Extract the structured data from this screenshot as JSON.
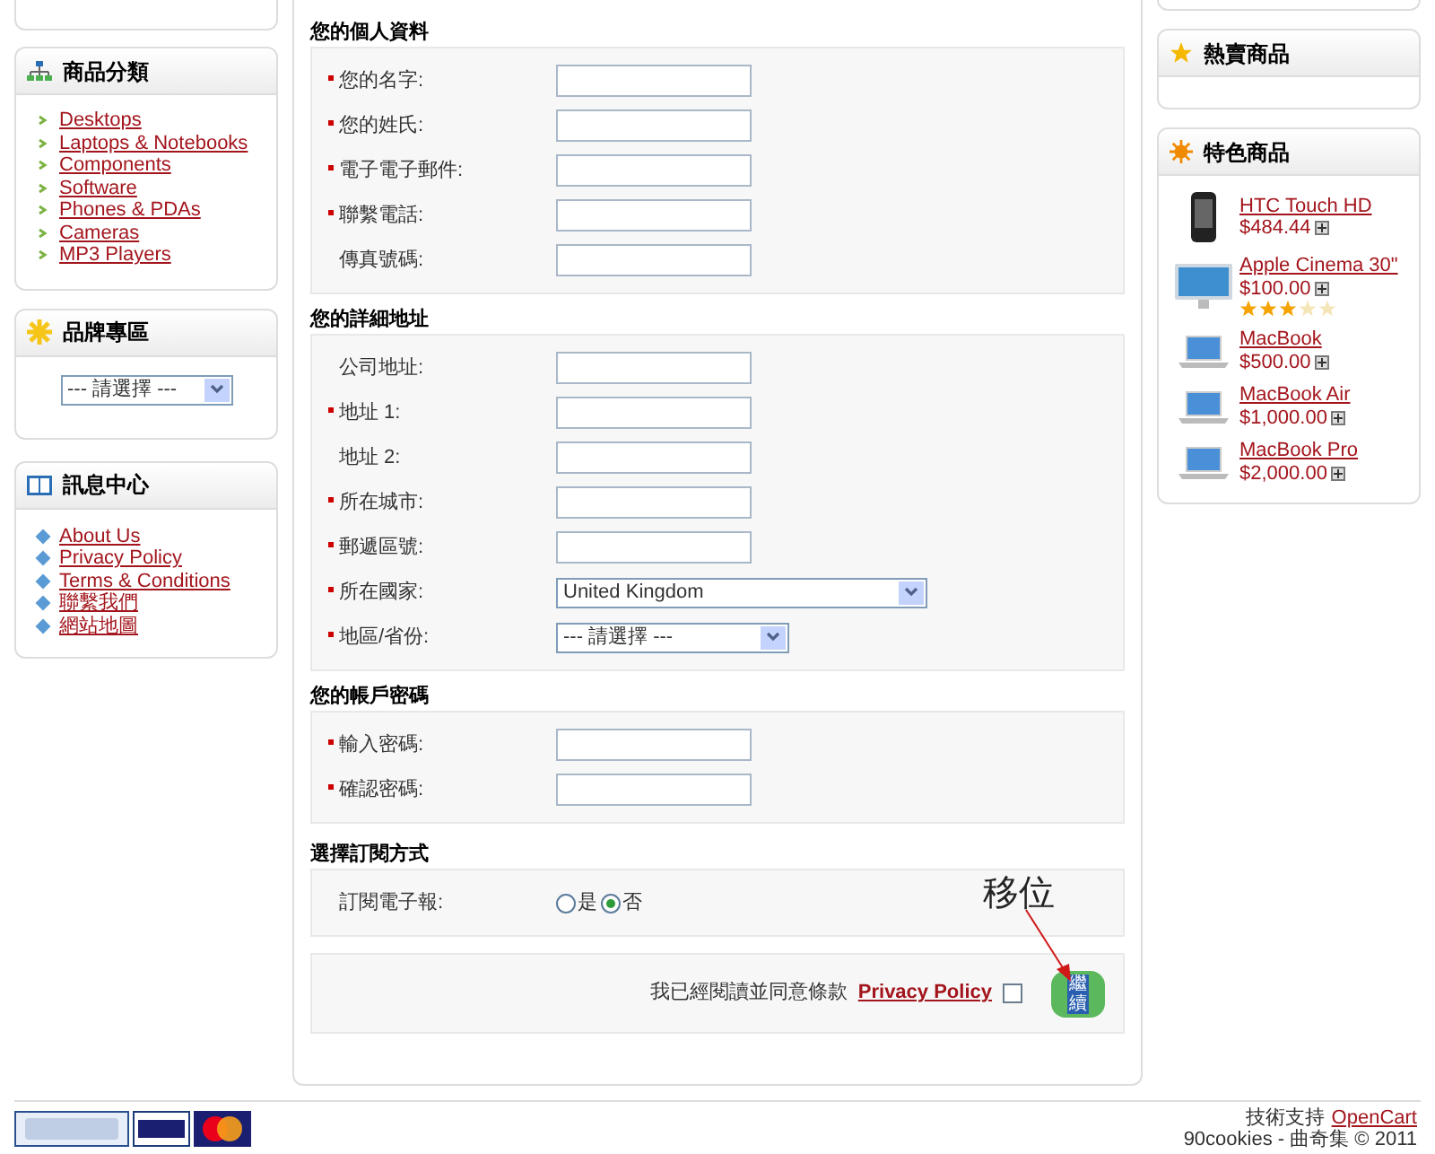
{
  "categories": {
    "title": "商品分類",
    "items": [
      "Desktops",
      "Laptops & Notebooks",
      "Components",
      "Software",
      "Phones & PDAs",
      "Cameras",
      "MP3 Players"
    ]
  },
  "brands": {
    "title": "品牌專區",
    "select_value": "--- 請選擇 ---"
  },
  "information": {
    "title": "訊息中心",
    "items": [
      "About Us",
      "Privacy Policy",
      "Terms & Conditions",
      "聯繫我們",
      "網站地圖"
    ]
  },
  "sections": [
    {
      "title": "您的個人資料",
      "fields": [
        {
          "label": "您的名字:",
          "required": true,
          "kind": "input"
        },
        {
          "label": "您的姓氏:",
          "required": true,
          "kind": "input"
        },
        {
          "label": "電子電子郵件:",
          "required": true,
          "kind": "input"
        },
        {
          "label": "聯繫電話:",
          "required": true,
          "kind": "input"
        },
        {
          "label": "傳真號碼:",
          "required": false,
          "kind": "input"
        }
      ]
    },
    {
      "title": "您的詳細地址",
      "fields": [
        {
          "label": "公司地址:",
          "required": false,
          "kind": "input"
        },
        {
          "label": "地址 1:",
          "required": true,
          "kind": "input"
        },
        {
          "label": "地址 2:",
          "required": false,
          "kind": "input"
        },
        {
          "label": "所在城市:",
          "required": true,
          "kind": "input"
        },
        {
          "label": "郵遞區號:",
          "required": true,
          "kind": "input"
        },
        {
          "label": "所在國家:",
          "required": true,
          "kind": "select-wide",
          "value": "United Kingdom"
        },
        {
          "label": "地區/省份:",
          "required": true,
          "kind": "select",
          "value": "--- 請選擇 ---"
        }
      ]
    },
    {
      "title": "您的帳戶密碼",
      "fields": [
        {
          "label": "輸入密碼:",
          "required": true,
          "kind": "input"
        },
        {
          "label": "確認密碼:",
          "required": true,
          "kind": "input"
        }
      ]
    },
    {
      "title": "選擇訂閱方式",
      "fields": [
        {
          "label": "訂閱電子報:",
          "required": false,
          "kind": "radio",
          "options": [
            {
              "label": "是",
              "selected": false
            },
            {
              "label": "否",
              "selected": true
            }
          ]
        }
      ]
    }
  ],
  "agreement": {
    "text": "我已經閱讀並同意條款",
    "link": "Privacy Policy",
    "checked": false,
    "button": "繼續"
  },
  "annotation": "移位",
  "bestsellers": {
    "title": "熱賣商品"
  },
  "featured": {
    "title": "特色商品",
    "items": [
      {
        "name": "HTC Touch HD",
        "price": "$484.44",
        "kind": "phone"
      },
      {
        "name": "Apple Cinema 30\"",
        "price": "$100.00",
        "kind": "monitor",
        "stars": 3
      },
      {
        "name": "MacBook",
        "price": "$500.00",
        "kind": "laptop"
      },
      {
        "name": "MacBook Air",
        "price": "$1,000.00",
        "kind": "laptop"
      },
      {
        "name": "MacBook Pro",
        "price": "$2,000.00",
        "kind": "laptop"
      }
    ]
  },
  "footer": {
    "powered_label": "技術支持",
    "powered_link": "OpenCart",
    "copyright": "90cookies - 曲奇集 © 2011"
  }
}
